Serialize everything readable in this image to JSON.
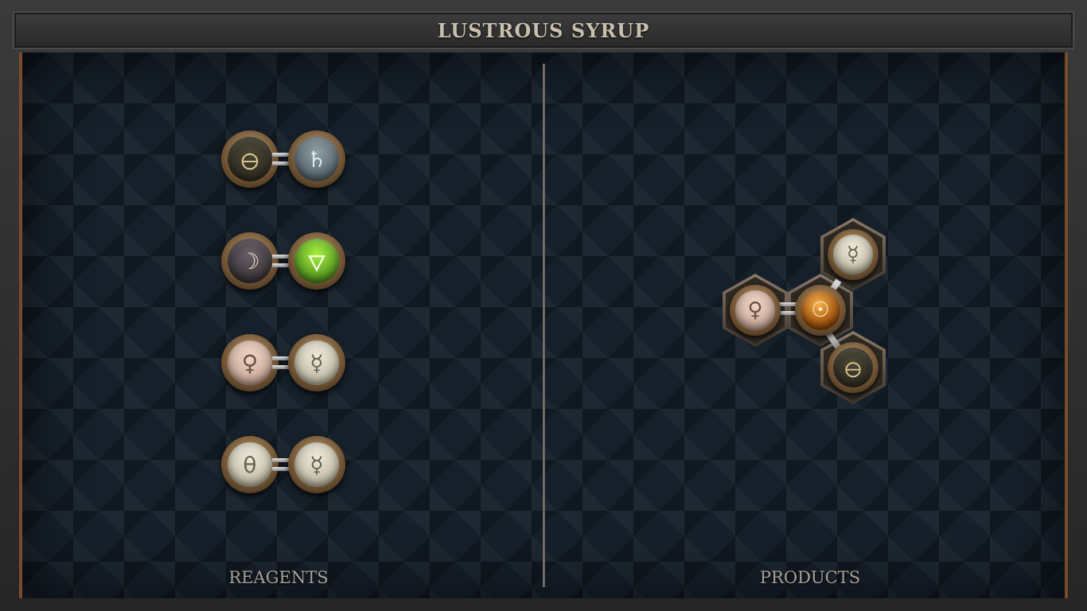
{
  "title": "LUSTROUS SYRUP",
  "panels": {
    "reagents_label": "REAGENTS",
    "products_label": "PRODUCTS"
  },
  "reagents": [
    {
      "left": {
        "element": "salt",
        "symbol": "🜔"
      },
      "right": {
        "element": "lead",
        "symbol": "♄"
      },
      "bond": "double"
    },
    {
      "left": {
        "element": "silver",
        "symbol": "☽"
      },
      "right": {
        "element": "vitae",
        "symbol": "🜄"
      },
      "bond": "double"
    },
    {
      "left": {
        "element": "copper",
        "symbol": "♀"
      },
      "right": {
        "element": "quicksilver",
        "symbol": "☿"
      },
      "bond": "double"
    },
    {
      "left": {
        "element": "quicksilver-salt",
        "symbol": "θ"
      },
      "right": {
        "element": "quicksilver",
        "symbol": "☿"
      },
      "bond": "double"
    }
  ],
  "product": {
    "center": {
      "element": "gold",
      "symbol": "☉"
    },
    "neighbors": [
      {
        "element": "copper",
        "symbol": "♀",
        "bond": "double"
      },
      {
        "element": "quicksilver",
        "symbol": "☿",
        "bond": "single"
      },
      {
        "element": "salt",
        "symbol": "🜔",
        "bond": "single"
      }
    ]
  },
  "colors": {
    "frame_accent": "#7a4a2a",
    "title_text": "#c9bfae",
    "label_text": "#a8a39a",
    "board_bg": "#16202b"
  }
}
